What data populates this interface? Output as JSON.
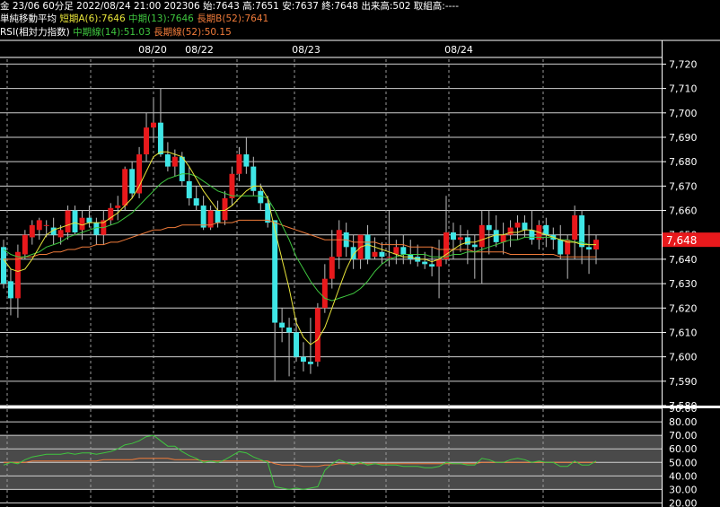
{
  "header": {
    "line1": "金 23/06 60分足 2022/08/24 21:00 202306 始:7643 高:7651 安:7637 終:7648 出来高:502 取組高:----",
    "ma_title": "単純移動平均",
    "ma_short": "短期A(6):7646",
    "ma_mid": "中期(13):7646",
    "ma_long": "長期B(52):7641",
    "rsi_title": "RSI(相対力指数)",
    "rsi_mid": "中期線(14):51.03",
    "rsi_long": "長期線(52):50.15"
  },
  "colors": {
    "up": "#e8191c",
    "down": "#3fe6e6",
    "ma_short": "#e8e43a",
    "ma_mid": "#3fc63f",
    "ma_long": "#f07b3a",
    "rsi_mid": "#3fc63f",
    "rsi_long": "#f07b3a",
    "price_tag": "#e8191c"
  },
  "chart_data": [
    {
      "type": "candlestick",
      "dates": [
        "08/20",
        "08/22",
        "08/23",
        "08/24"
      ],
      "ylim": [
        7580,
        7722
      ],
      "yticks": [
        "7,580",
        "7,590",
        "7,600",
        "7,610",
        "7,620",
        "7,630",
        "7,640",
        "7,650",
        "7,660",
        "7,670",
        "7,680",
        "7,690",
        "7,700",
        "7,710",
        "7,720"
      ],
      "ytick_values": [
        7580,
        7590,
        7600,
        7610,
        7620,
        7630,
        7640,
        7650,
        7660,
        7670,
        7680,
        7690,
        7700,
        7710,
        7720
      ],
      "current_price": "7,648",
      "current_value": 7648,
      "ohlc": [
        [
          7645,
          7648,
          7628,
          7630
        ],
        [
          7631,
          7636,
          7617,
          7624
        ],
        [
          7624,
          7646,
          7616,
          7643
        ],
        [
          7642,
          7652,
          7640,
          7650
        ],
        [
          7649,
          7656,
          7646,
          7654
        ],
        [
          7652,
          7657,
          7648,
          7656
        ],
        [
          7654,
          7656,
          7649,
          7654
        ],
        [
          7653,
          7657,
          7646,
          7650
        ],
        [
          7649,
          7654,
          7646,
          7652
        ],
        [
          7651,
          7662,
          7648,
          7660
        ],
        [
          7660,
          7662,
          7650,
          7651
        ],
        [
          7652,
          7660,
          7648,
          7657
        ],
        [
          7657,
          7662,
          7653,
          7655
        ],
        [
          7655,
          7657,
          7646,
          7650
        ],
        [
          7650,
          7660,
          7646,
          7656
        ],
        [
          7656,
          7663,
          7654,
          7661
        ],
        [
          7661,
          7666,
          7656,
          7662
        ],
        [
          7662,
          7678,
          7660,
          7677
        ],
        [
          7677,
          7680,
          7665,
          7667
        ],
        [
          7667,
          7686,
          7665,
          7683
        ],
        [
          7683,
          7700,
          7680,
          7694
        ],
        [
          7694,
          7706,
          7688,
          7696
        ],
        [
          7696,
          7710,
          7682,
          7683
        ],
        [
          7683,
          7688,
          7676,
          7678
        ],
        [
          7678,
          7685,
          7674,
          7682
        ],
        [
          7682,
          7684,
          7670,
          7672
        ],
        [
          7672,
          7678,
          7662,
          7665
        ],
        [
          7665,
          7670,
          7660,
          7662
        ],
        [
          7662,
          7666,
          7652,
          7653
        ],
        [
          7653,
          7662,
          7652,
          7660
        ],
        [
          7660,
          7664,
          7653,
          7655
        ],
        [
          7656,
          7668,
          7654,
          7665
        ],
        [
          7665,
          7678,
          7662,
          7675
        ],
        [
          7675,
          7686,
          7672,
          7683
        ],
        [
          7683,
          7690,
          7675,
          7678
        ],
        [
          7678,
          7682,
          7666,
          7668
        ],
        [
          7668,
          7671,
          7660,
          7663
        ],
        [
          7663,
          7666,
          7653,
          7655
        ],
        [
          7656,
          7620,
          7590,
          7614
        ],
        [
          7614,
          7620,
          7606,
          7612
        ],
        [
          7612,
          7616,
          7592,
          7610
        ],
        [
          7610,
          7616,
          7598,
          7600
        ],
        [
          7600,
          7606,
          7594,
          7598
        ],
        [
          7598,
          7616,
          7593,
          7597
        ],
        [
          7598,
          7622,
          7596,
          7620
        ],
        [
          7620,
          7638,
          7618,
          7632
        ],
        [
          7632,
          7652,
          7628,
          7641
        ],
        [
          7641,
          7656,
          7636,
          7652
        ],
        [
          7651,
          7655,
          7641,
          7645
        ],
        [
          7645,
          7650,
          7636,
          7640
        ],
        [
          7640,
          7650,
          7636,
          7650
        ],
        [
          7650,
          7654,
          7638,
          7640
        ],
        [
          7641,
          7649,
          7640,
          7643
        ],
        [
          7643,
          7647,
          7638,
          7641
        ],
        [
          7641,
          7660,
          7637,
          7641
        ],
        [
          7642,
          7648,
          7638,
          7645
        ],
        [
          7645,
          7650,
          7638,
          7642
        ],
        [
          7642,
          7648,
          7638,
          7640
        ],
        [
          7641,
          7646,
          7637,
          7639
        ],
        [
          7639,
          7643,
          7636,
          7638
        ],
        [
          7638,
          7645,
          7633,
          7637
        ],
        [
          7637,
          7648,
          7624,
          7640
        ],
        [
          7640,
          7666,
          7638,
          7651
        ],
        [
          7651,
          7655,
          7640,
          7648
        ],
        [
          7648,
          7654,
          7643,
          7649
        ],
        [
          7649,
          7652,
          7638,
          7646
        ],
        [
          7646,
          7650,
          7632,
          7645
        ],
        [
          7645,
          7660,
          7630,
          7654
        ],
        [
          7654,
          7660,
          7642,
          7652
        ],
        [
          7652,
          7658,
          7645,
          7647
        ],
        [
          7647,
          7655,
          7642,
          7650
        ],
        [
          7650,
          7656,
          7645,
          7653
        ],
        [
          7653,
          7658,
          7648,
          7655
        ],
        [
          7655,
          7658,
          7649,
          7652
        ],
        [
          7652,
          7660,
          7646,
          7648
        ],
        [
          7648,
          7656,
          7644,
          7654
        ],
        [
          7654,
          7657,
          7645,
          7650
        ],
        [
          7650,
          7653,
          7644,
          7648
        ],
        [
          7648,
          7654,
          7640,
          7642
        ],
        [
          7642,
          7650,
          7632,
          7648
        ],
        [
          7648,
          7662,
          7640,
          7658
        ],
        [
          7658,
          7660,
          7638,
          7645
        ],
        [
          7645,
          7654,
          7634,
          7644
        ],
        [
          7644,
          7650,
          7638,
          7648
        ]
      ],
      "ma_short": [
        7640,
        7636,
        7635,
        7636,
        7640,
        7645,
        7650,
        7652,
        7653,
        7654,
        7655,
        7654,
        7655,
        7655,
        7655,
        7657,
        7659,
        7662,
        7665,
        7670,
        7676,
        7682,
        7684,
        7684,
        7683,
        7682,
        7678,
        7673,
        7668,
        7664,
        7660,
        7660,
        7662,
        7665,
        7668,
        7670,
        7670,
        7665,
        7652,
        7640,
        7628,
        7614,
        7608,
        7605,
        7607,
        7612,
        7620,
        7628,
        7636,
        7642,
        7645,
        7646,
        7645,
        7644,
        7643,
        7642,
        7641,
        7641,
        7640,
        7640,
        7639,
        7640,
        7642,
        7644,
        7646,
        7647,
        7647,
        7648,
        7649,
        7650,
        7650,
        7651,
        7651,
        7652,
        7652,
        7651,
        7650,
        7649,
        7648,
        7647,
        7647,
        7646,
        7646,
        7646
      ],
      "ma_mid": [
        7644,
        7642,
        7641,
        7641,
        7642,
        7643,
        7645,
        7646,
        7647,
        7649,
        7650,
        7651,
        7652,
        7653,
        7653,
        7654,
        7655,
        7657,
        7659,
        7662,
        7665,
        7668,
        7671,
        7673,
        7674,
        7675,
        7675,
        7674,
        7672,
        7670,
        7668,
        7667,
        7666,
        7666,
        7666,
        7666,
        7666,
        7665,
        7660,
        7654,
        7648,
        7641,
        7636,
        7631,
        7627,
        7624,
        7623,
        7624,
        7625,
        7626,
        7628,
        7631,
        7635,
        7638,
        7640,
        7641,
        7642,
        7642,
        7642,
        7642,
        7641,
        7641,
        7641,
        7642,
        7642,
        7643,
        7643,
        7644,
        7645,
        7646,
        7647,
        7648,
        7648,
        7649,
        7649,
        7649,
        7649,
        7649,
        7648,
        7648,
        7647,
        7647,
        7646,
        7646
      ],
      "ma_long": [
        7640,
        7640,
        7640,
        7641,
        7641,
        7642,
        7642,
        7643,
        7643,
        7644,
        7644,
        7645,
        7645,
        7646,
        7646,
        7647,
        7647,
        7648,
        7649,
        7650,
        7651,
        7652,
        7652,
        7653,
        7653,
        7654,
        7654,
        7654,
        7654,
        7654,
        7655,
        7655,
        7655,
        7656,
        7656,
        7656,
        7656,
        7656,
        7655,
        7654,
        7653,
        7652,
        7651,
        7650,
        7649,
        7648,
        7648,
        7648,
        7648,
        7647,
        7647,
        7647,
        7647,
        7646,
        7646,
        7646,
        7646,
        7645,
        7645,
        7645,
        7645,
        7644,
        7644,
        7644,
        7644,
        7644,
        7643,
        7643,
        7643,
        7643,
        7643,
        7642,
        7642,
        7642,
        7642,
        7642,
        7642,
        7642,
        7641,
        7641,
        7641,
        7641,
        7641,
        7641
      ]
    },
    {
      "type": "line",
      "ylim": [
        17,
        90
      ],
      "yticks": [
        "90.00",
        "80.00",
        "70.00",
        "60.00",
        "50.00",
        "40.00",
        "30.00",
        "20.00"
      ],
      "ytick_values": [
        90,
        80,
        70,
        60,
        50,
        40,
        30,
        20
      ],
      "band": [
        30,
        70
      ],
      "series": [
        {
          "name": "中期線(14)",
          "values": [
            48,
            50,
            49,
            52,
            54,
            55,
            56,
            56,
            56,
            57,
            56,
            57,
            57,
            56,
            57,
            58,
            60,
            63,
            64,
            66,
            69,
            70,
            66,
            62,
            62,
            58,
            55,
            53,
            50,
            51,
            50,
            52,
            55,
            58,
            57,
            54,
            52,
            50,
            32,
            31,
            30,
            31,
            30,
            31,
            32,
            44,
            49,
            52,
            50,
            48,
            50,
            48,
            49,
            48,
            48,
            48,
            47,
            47,
            47,
            46,
            46,
            47,
            50,
            49,
            49,
            48,
            48,
            53,
            52,
            50,
            50,
            52,
            53,
            52,
            50,
            51,
            50,
            50,
            47,
            47,
            51,
            48,
            48,
            51
          ]
        },
        {
          "name": "長期線(52)",
          "values": [
            50,
            50,
            50,
            50,
            51,
            51,
            51,
            51,
            51,
            51,
            51,
            51,
            51,
            51,
            52,
            52,
            52,
            52,
            52,
            53,
            53,
            53,
            53,
            53,
            52,
            52,
            52,
            52,
            51,
            51,
            51,
            51,
            51,
            51,
            51,
            51,
            51,
            51,
            49,
            48,
            48,
            48,
            47,
            47,
            47,
            48,
            48,
            49,
            49,
            49,
            49,
            49,
            49,
            49,
            49,
            49,
            49,
            49,
            49,
            49,
            49,
            49,
            49,
            49,
            49,
            49,
            49,
            50,
            50,
            50,
            50,
            50,
            50,
            50,
            50,
            50,
            50,
            50,
            50,
            50,
            50,
            50,
            50,
            50
          ]
        }
      ]
    }
  ]
}
